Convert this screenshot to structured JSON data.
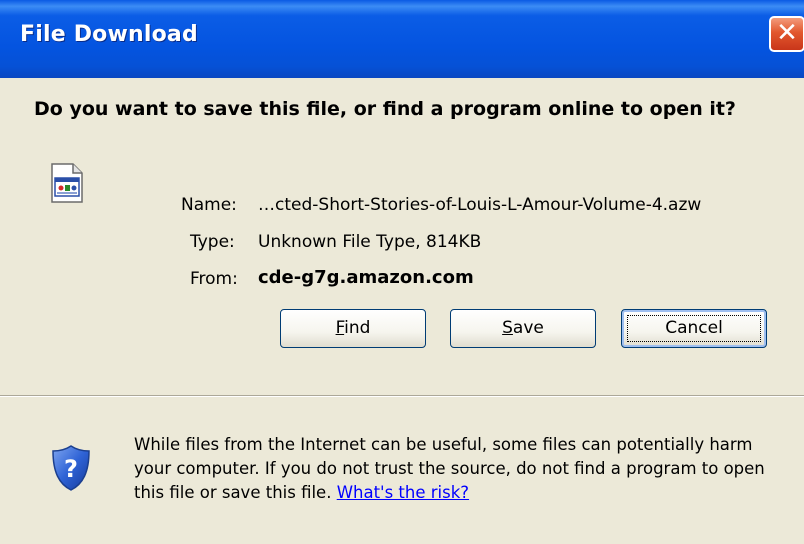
{
  "window": {
    "title": "File Download",
    "close_label": "✕"
  },
  "prompt": {
    "heading": "Do you want to save this file, or find a program online to open it?"
  },
  "file": {
    "icon": "azw-file-icon",
    "name_label": "Name:",
    "name_value": "…cted-Short-Stories-of-Louis-L-Amour-Volume-4.azw",
    "type_label": "Type:",
    "type_value": "Unknown File Type, 814KB",
    "from_label": "From:",
    "from_value": "cde-g7g.amazon.com"
  },
  "buttons": {
    "find_accel": "F",
    "find_rest": "ind",
    "save_accel": "S",
    "save_rest": "ave",
    "cancel_label": "Cancel"
  },
  "warning": {
    "icon": "shield-question-icon",
    "text": "While files from the Internet can be useful, some files can potentially harm your computer. If you do not trust the source, do not find a program to open this file or save this file.",
    "link_text": "What's the risk?"
  },
  "colors": {
    "titlebar": "#0454e0",
    "background": "#ece9d8",
    "link": "#0000ff",
    "close": "#e2572d"
  }
}
